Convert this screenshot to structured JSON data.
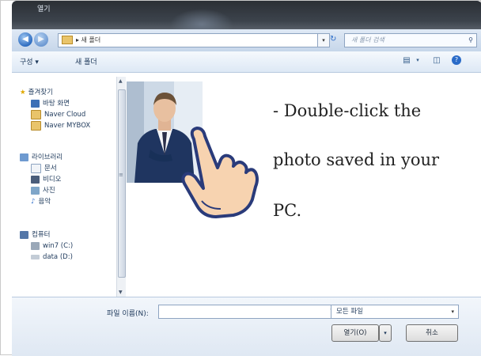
{
  "window": {
    "title": "열기"
  },
  "address": {
    "path": "▸ 새 폴더",
    "dropdown": "▾",
    "refresh": "↻"
  },
  "search": {
    "placeholder": "새 폴더 검색",
    "icon": "search-icon"
  },
  "toolbar": {
    "organize": "구성 ▾",
    "new_folder": "새 폴더"
  },
  "nav": {
    "favorites_header": "즐겨찾기",
    "favorites": [
      "바탕 화면",
      "Naver Cloud",
      "Naver MYBOX"
    ],
    "library_header": "라이브러리",
    "libraries": [
      "문서",
      "비디오",
      "사진",
      "음악"
    ],
    "computer_header": "컴퓨터",
    "drives": [
      "win7 (C:)",
      "data (D:)"
    ]
  },
  "instruction": {
    "line1": "- Double-click the",
    "line2": "photo saved in your",
    "line3": "PC."
  },
  "bottom": {
    "filename_label": "파일 이름(N):",
    "filename_value": "",
    "filetype": "모든 파일",
    "open_label": "열기(O)",
    "cancel_label": "취소"
  },
  "colors": {
    "accent": "#2d6cc0",
    "hand_fill": "#f7d3b0",
    "hand_stroke": "#2a3b7a"
  }
}
